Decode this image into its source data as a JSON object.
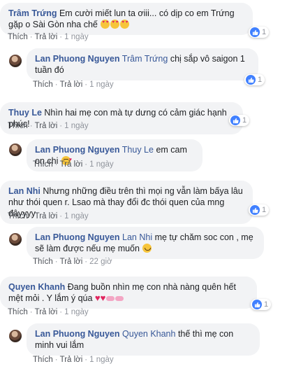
{
  "actions": {
    "like": "Thích",
    "reply": "Trả lời",
    "sep": "·"
  },
  "colors": {
    "author": "#385898",
    "bubble": "#f2f3f5",
    "like": "#4080ff"
  },
  "comments": [
    {
      "author": "Trâm Trứng",
      "text": "Em cười miết lun ta ơiii... có dịp co em Trứng gặp o Sài Gòn nha chế",
      "emojis": [
        "heart-eyes",
        "heart-eyes",
        "heart-eyes"
      ],
      "time": "1 ngày",
      "reactions": "1"
    },
    {
      "author": "Lan Phuong Nguyen",
      "tag": "Trâm Trứng",
      "text": "chị sắp vô saigon 1 tuần đó",
      "time": "1 ngày",
      "reactions": "1"
    },
    {
      "author": "Thuy Le",
      "text": "Nhìn hai mẹ con mà tự dưng có cảm giác hạnh phúc!",
      "time": "1 ngày",
      "reactions": "1"
    },
    {
      "author": "Lan Phuong Nguyen",
      "tag": "Thuy Le",
      "text": "em cam on chi",
      "emojis": [
        "kiss"
      ],
      "time": "1 ngày"
    },
    {
      "author": "Lan Nhi",
      "text": "Nhưng những điều trên thì mọi ng vẫn làm bấya lâu như thói quen r. Lsao mà thay đổi đc thói quen của mng đâyyyy",
      "time": "1 ngày",
      "reactions": "1"
    },
    {
      "author": "Lan Phuong Nguyen",
      "tag": "Lan Nhi",
      "text": "mẹ tự chăm soc con , mẹ sẽ làm được nếu mẹ muốn",
      "emojis": [
        "smile"
      ],
      "time": "22 giờ"
    },
    {
      "author": "Quyen Khanh",
      "text": "Đang buồn nhìn mẹ con nhà nàng quên hết mệt mỏi . Y lắm ý qúa",
      "emojis": [
        "heart",
        "heart",
        "pill",
        "pill"
      ],
      "time": "1 ngày",
      "reactions": "1"
    },
    {
      "author": "Lan Phuong Nguyen",
      "tag": "Quyen Khanh",
      "text": "thế thì mẹ con minh vui lắm",
      "time": "1 ngày"
    }
  ]
}
